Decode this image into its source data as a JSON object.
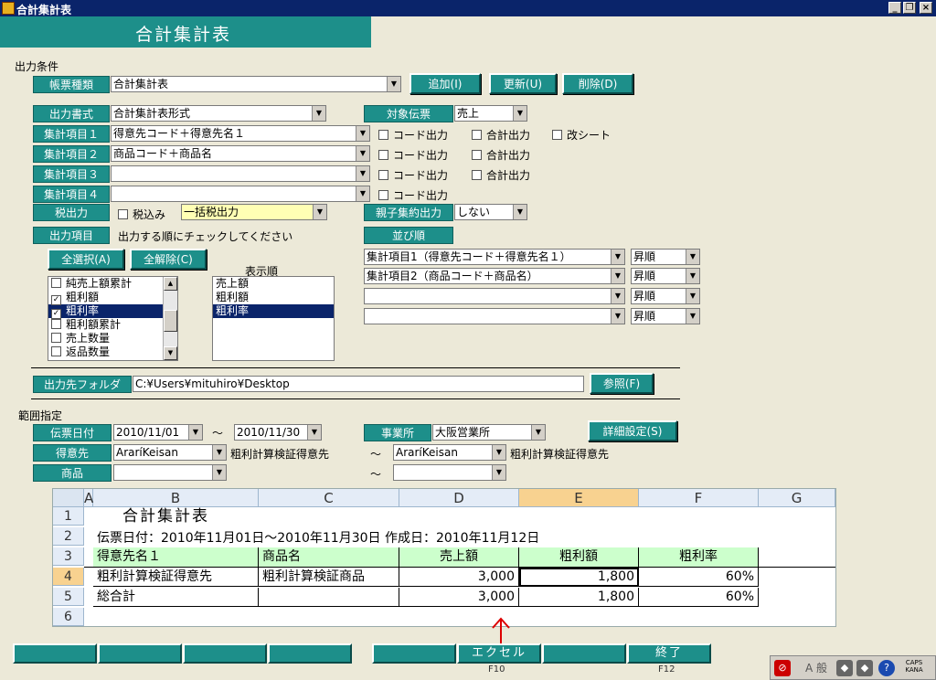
{
  "window": {
    "title": "合計集計表"
  },
  "header": {
    "title": "合計集計表"
  },
  "output_conditions": {
    "section_label": "出力条件",
    "report_type": {
      "label": "帳票種類",
      "value": "合計集計表"
    },
    "buttons": {
      "add": "追加(I)",
      "update": "更新(U)",
      "delete": "削除(D)"
    },
    "output_format": {
      "label": "出力書式",
      "value": "合計集計表形式"
    },
    "target_slip": {
      "label": "対象伝票",
      "value": "売上"
    },
    "items": [
      {
        "label": "集計項目１",
        "value": "得意先コード＋得意先名１",
        "code": "コード出力",
        "total": "合計出力",
        "sheet": "改シート"
      },
      {
        "label": "集計項目２",
        "value": "商品コード＋商品名",
        "code": "コード出力",
        "total": "合計出力"
      },
      {
        "label": "集計項目３",
        "value": "",
        "code": "コード出力",
        "total": "合計出力"
      },
      {
        "label": "集計項目４",
        "value": "",
        "code": "コード出力"
      }
    ],
    "tax": {
      "label": "税出力",
      "checkbox": "税込み",
      "value": "一括税出力"
    },
    "parent_child": {
      "label": "親子集約出力",
      "value": "しない"
    },
    "output_items": {
      "label": "出力項目",
      "hint": "出力する順にチェックしてください"
    },
    "sort": {
      "label": "並び順",
      "rows": [
        {
          "item": "集計項目1（得意先コード＋得意先名１）",
          "order": "昇順"
        },
        {
          "item": "集計項目2（商品コード＋商品名）",
          "order": "昇順"
        },
        {
          "item": "",
          "order": "昇順"
        },
        {
          "item": "",
          "order": "昇順"
        }
      ]
    },
    "select_all": "全選択(A)",
    "deselect_all": "全解除(C)",
    "display_order_label": "表示順",
    "item_list": [
      {
        "label": "純売上額累計",
        "checked": false
      },
      {
        "label": "粗利額",
        "checked": true
      },
      {
        "label": "粗利率",
        "checked": true,
        "selected": true
      },
      {
        "label": "粗利額累計",
        "checked": false
      },
      {
        "label": "売上数量",
        "checked": false
      },
      {
        "label": "返品数量",
        "checked": false
      }
    ],
    "display_order": [
      "売上額",
      "粗利額",
      "粗利率"
    ],
    "folder": {
      "label": "出力先フォルダ",
      "value": "C:¥Users¥mituhiro¥Desktop",
      "browse": "参照(F)"
    }
  },
  "range": {
    "section_label": "範囲指定",
    "slip_date": {
      "label": "伝票日付",
      "from": "2010/11/01",
      "tilde": "～",
      "to": "2010/11/30"
    },
    "office": {
      "label": "事業所",
      "value": "大阪営業所"
    },
    "detail_button": "詳細設定(S)",
    "customer": {
      "label": "得意先",
      "from": "AraríKeisan",
      "from_name": "粗利計算検証得意先",
      "tilde": "～",
      "to": "AraríKeisan",
      "to_name": "粗利計算検証得意先"
    },
    "product": {
      "label": "商品",
      "tilde": "～"
    }
  },
  "sheet": {
    "columns": [
      "A",
      "B",
      "C",
      "D",
      "E",
      "F",
      "G"
    ],
    "rows": [
      "1",
      "2",
      "3",
      "4",
      "5",
      "6"
    ],
    "title": "合計集計表",
    "subtitle": "伝票日付：2010年11月01日～2010年11月30日 作成日：2010年11月12日",
    "headers": [
      "得意先名１",
      "商品名",
      "売上額",
      "粗利額",
      "粗利率"
    ],
    "data": [
      [
        "粗利計算検証得意先",
        "粗利計算検証商品",
        "3,000",
        "1,800",
        "60%"
      ],
      [
        "総合計",
        "",
        "3,000",
        "1,800",
        "60%"
      ]
    ]
  },
  "fkeys": [
    {
      "label": "",
      "key": ""
    },
    {
      "label": "",
      "key": ""
    },
    {
      "label": "",
      "key": ""
    },
    {
      "label": "",
      "key": ""
    },
    {
      "label": "",
      "key": ""
    },
    {
      "label": "エクセル",
      "key": "F10"
    },
    {
      "label": "",
      "key": ""
    },
    {
      "label": "終了",
      "key": "F12"
    }
  ],
  "tray": {
    "caps": "CAPS",
    "kana": "KANA",
    "ime": "A 般"
  }
}
